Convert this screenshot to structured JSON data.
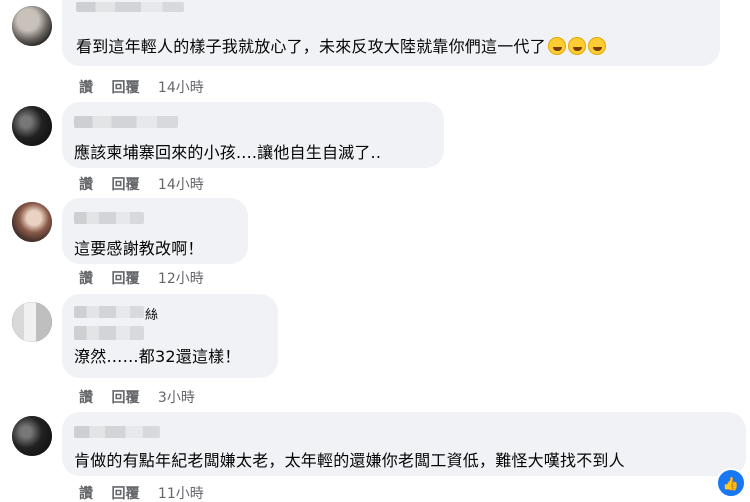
{
  "comments": [
    {
      "text": "看到這年輕人的樣子我就放心了，未來反攻大陸就靠你們這一代了",
      "reactions": [
        "laughing-crying-emoji",
        "laughing-crying-emoji",
        "laughing-crying-emoji"
      ],
      "like_label": "讚",
      "reply_label": "回覆",
      "time": "14小時"
    },
    {
      "text": "應該柬埔寨回來的小孩....讓他自生自滅了..",
      "like_label": "讚",
      "reply_label": "回覆",
      "time": "14小時"
    },
    {
      "text": "這要感謝教改啊！",
      "like_label": "讚",
      "reply_label": "回覆",
      "time": "12小時"
    },
    {
      "author_suffix": "絲",
      "text": "潦然……都32還這樣！",
      "like_label": "讚",
      "reply_label": "回覆",
      "time": "3小時"
    },
    {
      "text": "肯做的有點年紀老闆嫌太老，太年輕的還嫌你老闆工資低，難怪大嘆找不到人",
      "like_label": "讚",
      "reply_label": "回覆",
      "time": "11小時"
    }
  ],
  "colors": {
    "bubble_bg": "#f0f2f5",
    "meta_text": "#65676b",
    "badge": "#1877f2"
  }
}
